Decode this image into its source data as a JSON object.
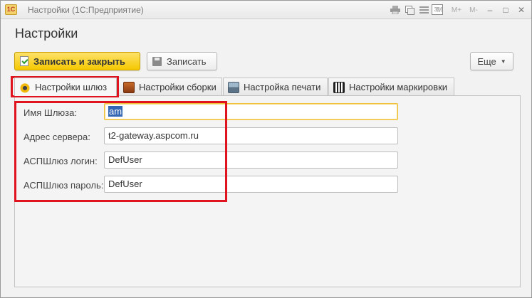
{
  "window": {
    "app_logo": "1С",
    "title": "Настройки  (1С:Предприятие)",
    "controls": {
      "minimize": "–",
      "maximize": "□",
      "close": "✕"
    },
    "toolbar_marks": {
      "m": "M",
      "m_plus": "M+",
      "m_minus": "M-"
    }
  },
  "page": {
    "title": "Настройки"
  },
  "toolbar": {
    "save_close_label": "Записать и закрыть",
    "save_label": "Записать",
    "more_label": "Еще"
  },
  "tabs": [
    {
      "label": "Настройки шлюз",
      "icon": "gear-icon",
      "active": true
    },
    {
      "label": "Настройки сборки",
      "icon": "box-icon",
      "active": false
    },
    {
      "label": "Настройка печати",
      "icon": "printer-icon",
      "active": false
    },
    {
      "label": "Настройки маркировки",
      "icon": "qr-icon",
      "active": false
    }
  ],
  "form": {
    "gateway_name": {
      "label": "Имя Шлюза:",
      "value": "am"
    },
    "server_address": {
      "label": "Адрес сервера:",
      "value": "t2-gateway.aspcom.ru"
    },
    "login": {
      "label": "АСПШлюз логин:",
      "value": "DefUser"
    },
    "password": {
      "label": "АСПШлюз пароль:",
      "value": "DefUser"
    }
  },
  "colors": {
    "primary_button": "#f5c800",
    "highlight_frame": "#e0141e",
    "focus_border": "#f0c23c",
    "selection": "#3467b4"
  }
}
